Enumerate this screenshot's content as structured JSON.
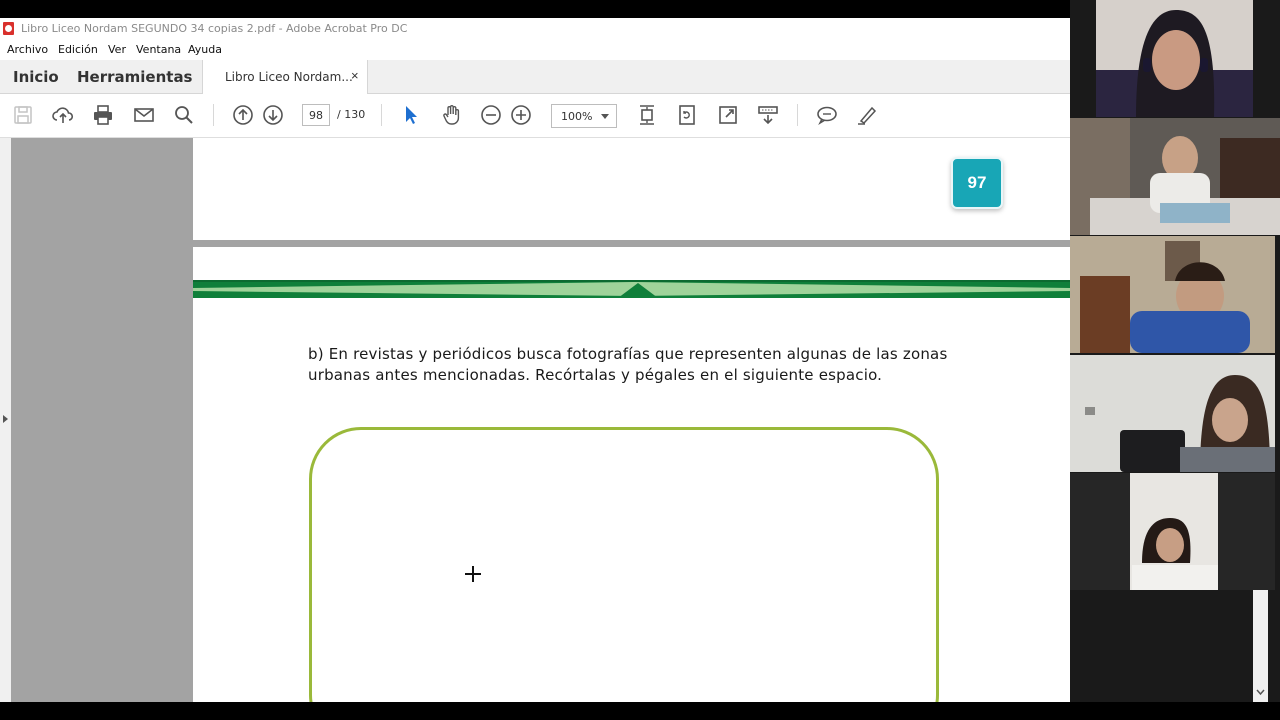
{
  "window": {
    "title": "Libro Liceo Nordam SEGUNDO 34 copias   2.pdf - Adobe Acrobat Pro DC"
  },
  "menu": {
    "items": [
      "Archivo",
      "Edición",
      "Ver",
      "Ventana",
      "Ayuda"
    ]
  },
  "tabs": {
    "home": "Inicio",
    "tools": "Herramientas",
    "document": "Libro Liceo Nordam...",
    "close_glyph": "×"
  },
  "toolbar": {
    "page_current": "98",
    "page_total": "/ 130",
    "zoom": "100%",
    "icons": [
      "save-icon",
      "upload-icon",
      "print-icon",
      "email-icon",
      "search-icon",
      "page-up-icon",
      "page-down-icon",
      "select-cursor-icon",
      "hand-icon",
      "zoom-out-icon",
      "zoom-in-icon",
      "fit-page-icon",
      "rotate-icon",
      "full-screen-icon",
      "scroll-mode-icon",
      "comment-icon",
      "highlight-icon"
    ]
  },
  "document": {
    "page_badge": "97",
    "instruction": "b) En revistas y periódicos busca fotografías que representen algunas de las zonas urbanas antes mencionadas. Recórtalas y pégales en el siguiente espacio.",
    "colors": {
      "badge": "#18a6b6",
      "band_dark": "#0f7f3a",
      "band_light": "#9fd39a",
      "frame": "#9ab93a"
    }
  },
  "participants": {
    "count": 5
  }
}
